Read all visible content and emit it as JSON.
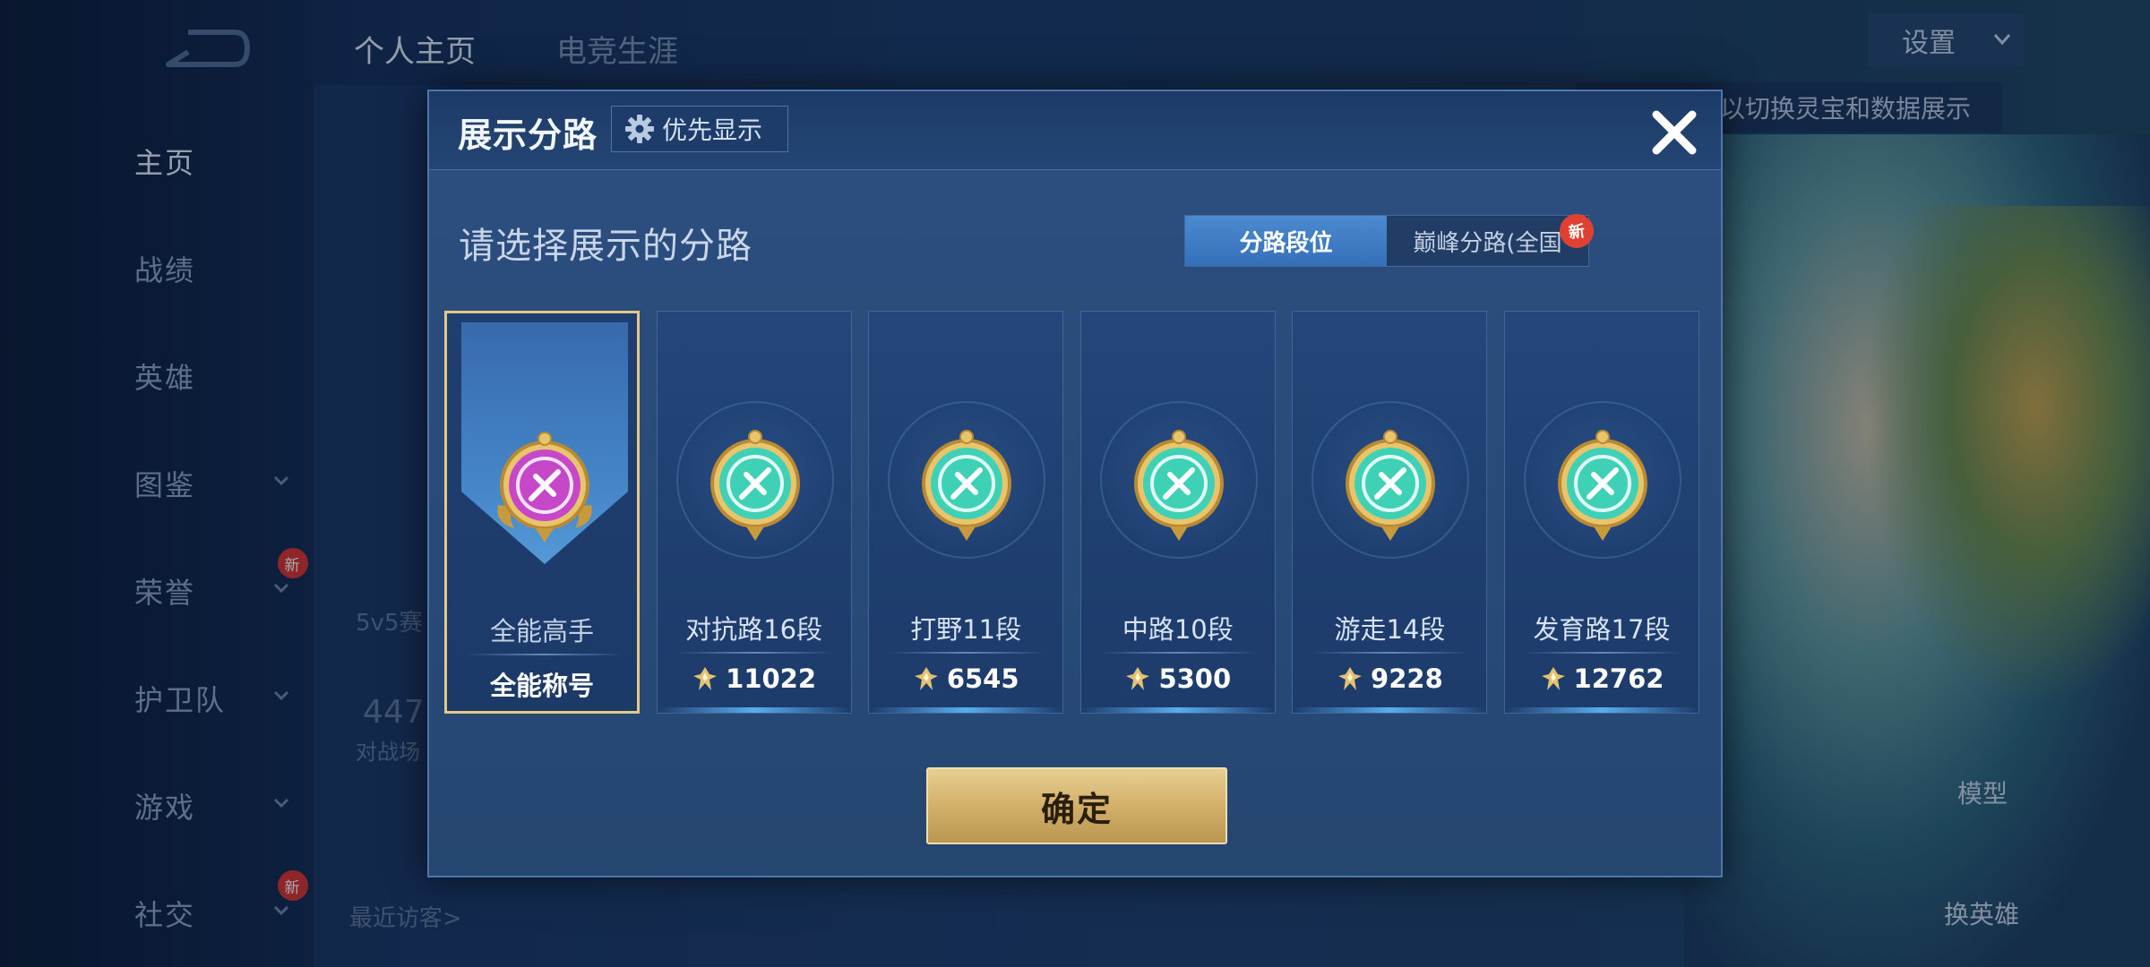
{
  "background": {
    "nav": [
      {
        "label": "主页",
        "active": true,
        "chevron": false,
        "new": false
      },
      {
        "label": "战绩",
        "active": false,
        "chevron": false,
        "new": false
      },
      {
        "label": "英雄",
        "active": false,
        "chevron": false,
        "new": false
      },
      {
        "label": "图鉴",
        "active": false,
        "chevron": true,
        "new": false
      },
      {
        "label": "荣誉",
        "active": false,
        "chevron": true,
        "new": true
      },
      {
        "label": "护卫队",
        "active": false,
        "chevron": true,
        "new": false
      },
      {
        "label": "游戏",
        "active": false,
        "chevron": true,
        "new": false
      },
      {
        "label": "社交",
        "active": false,
        "chevron": true,
        "new": true
      }
    ],
    "new_badge": "新",
    "tabs": [
      "个人主页",
      "电竞生涯"
    ],
    "settings_label": "设置",
    "notice_text": "以切换灵宝和数据展示",
    "recent_visitors": "最近访客>",
    "mode_text": "5v5赛",
    "count_text": "447",
    "count_sub": "对战场",
    "model_label": "模型",
    "change_hero_label": "换英雄"
  },
  "modal": {
    "title": "展示分路",
    "priority_label": "优先显示",
    "subtitle": "请选择展示的分路",
    "segments": {
      "active": "分路段位",
      "inactive": "巅峰分路(全国",
      "new_badge": "新"
    },
    "cards": [
      {
        "label": "全能高手",
        "value": "全能称号",
        "selected": true,
        "emblem": "all-round-purple-emblem-icon"
      },
      {
        "label": "对抗路16段",
        "value": "11022",
        "selected": false,
        "emblem": "clash-lane-emblem-icon"
      },
      {
        "label": "打野11段",
        "value": "6545",
        "selected": false,
        "emblem": "jungle-emblem-icon"
      },
      {
        "label": "中路10段",
        "value": "5300",
        "selected": false,
        "emblem": "mid-lane-emblem-icon"
      },
      {
        "label": "游走14段",
        "value": "9228",
        "selected": false,
        "emblem": "roam-emblem-icon"
      },
      {
        "label": "发育路17段",
        "value": "12762",
        "selected": false,
        "emblem": "farm-lane-emblem-icon"
      }
    ],
    "confirm_label": "确定"
  },
  "colors": {
    "accent_gold": "#e5c78a",
    "teal_emblem": "#3fd1b6",
    "purple_emblem": "#c648c8",
    "active_tab": "#3f80c8"
  }
}
